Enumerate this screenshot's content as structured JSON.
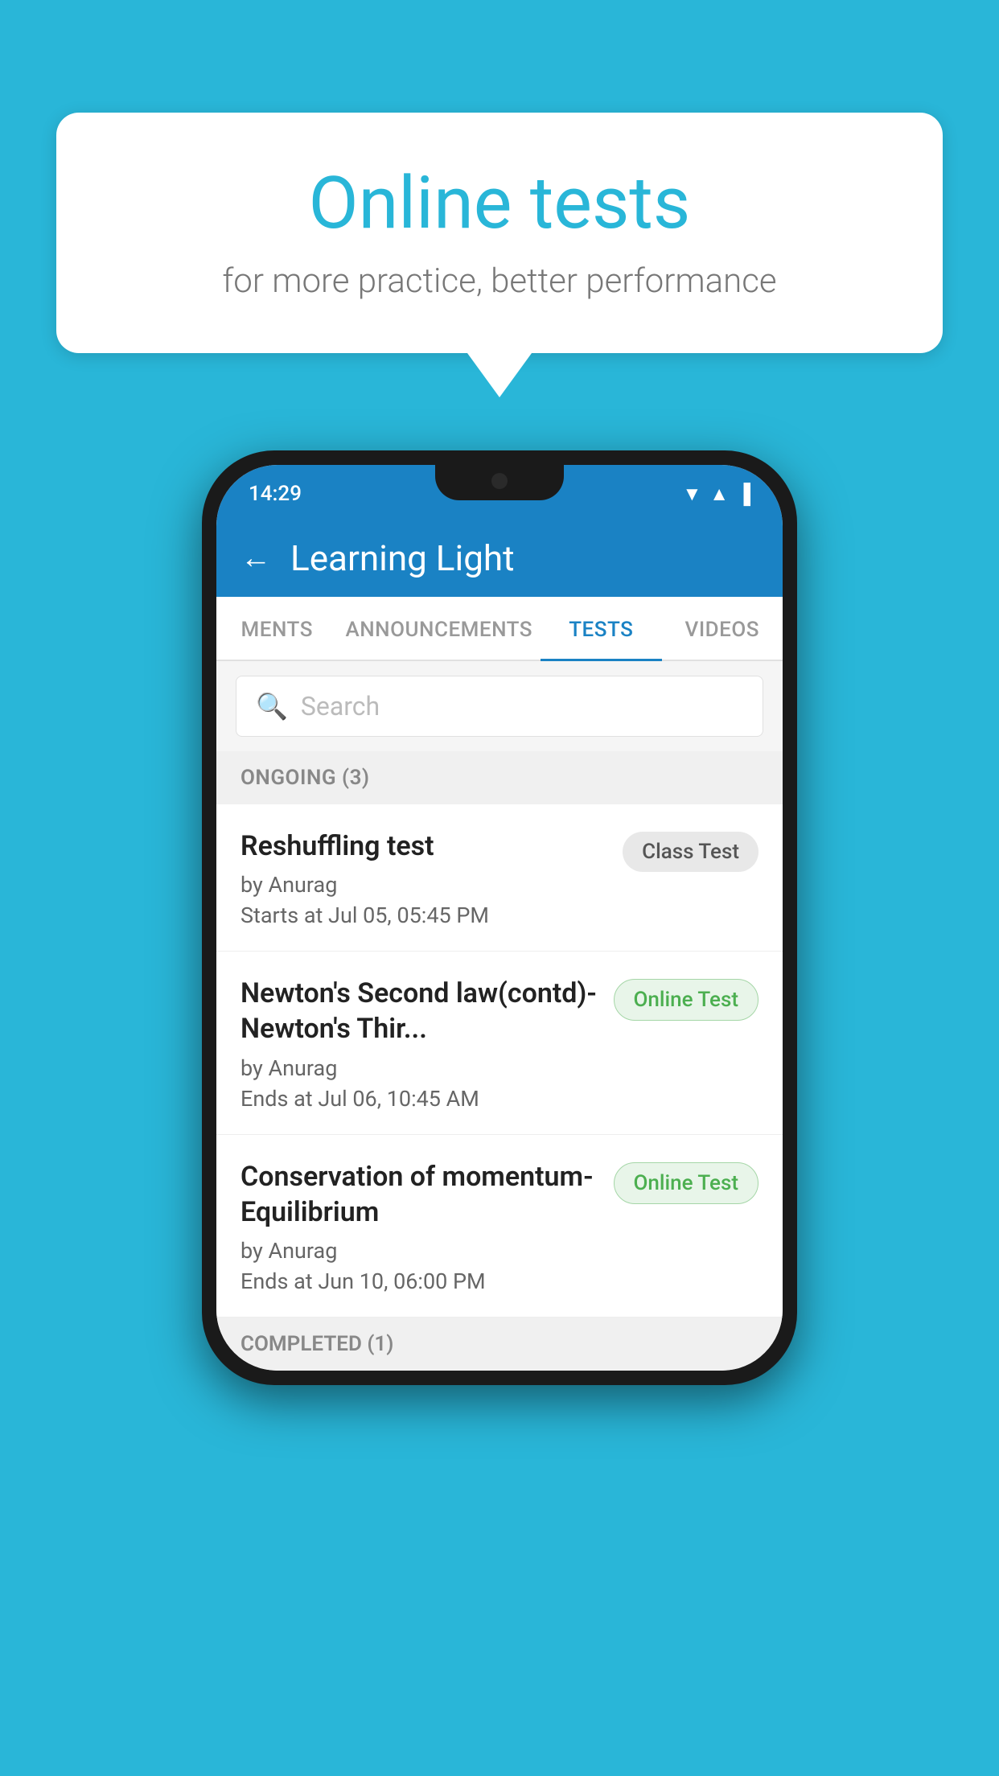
{
  "background_color": "#29b6d8",
  "bubble": {
    "title": "Online tests",
    "subtitle": "for more practice, better performance"
  },
  "status_bar": {
    "time": "14:29",
    "icons": [
      "wifi",
      "signal",
      "battery"
    ]
  },
  "app_bar": {
    "title": "Learning Light",
    "back_label": "←"
  },
  "tabs": [
    {
      "label": "MENTS",
      "active": false
    },
    {
      "label": "ANNOUNCEMENTS",
      "active": false
    },
    {
      "label": "TESTS",
      "active": true
    },
    {
      "label": "VIDEOS",
      "active": false
    }
  ],
  "search": {
    "placeholder": "Search"
  },
  "ongoing_section": {
    "label": "ONGOING (3)"
  },
  "tests": [
    {
      "name": "Reshuffling test",
      "by": "by Anurag",
      "time": "Starts at  Jul 05, 05:45 PM",
      "badge": "Class Test",
      "badge_type": "class"
    },
    {
      "name": "Newton's Second law(contd)-Newton's Thir...",
      "by": "by Anurag",
      "time": "Ends at  Jul 06, 10:45 AM",
      "badge": "Online Test",
      "badge_type": "online"
    },
    {
      "name": "Conservation of momentum-Equilibrium",
      "by": "by Anurag",
      "time": "Ends at  Jun 10, 06:00 PM",
      "badge": "Online Test",
      "badge_type": "online"
    }
  ],
  "completed_section": {
    "label": "COMPLETED (1)"
  }
}
